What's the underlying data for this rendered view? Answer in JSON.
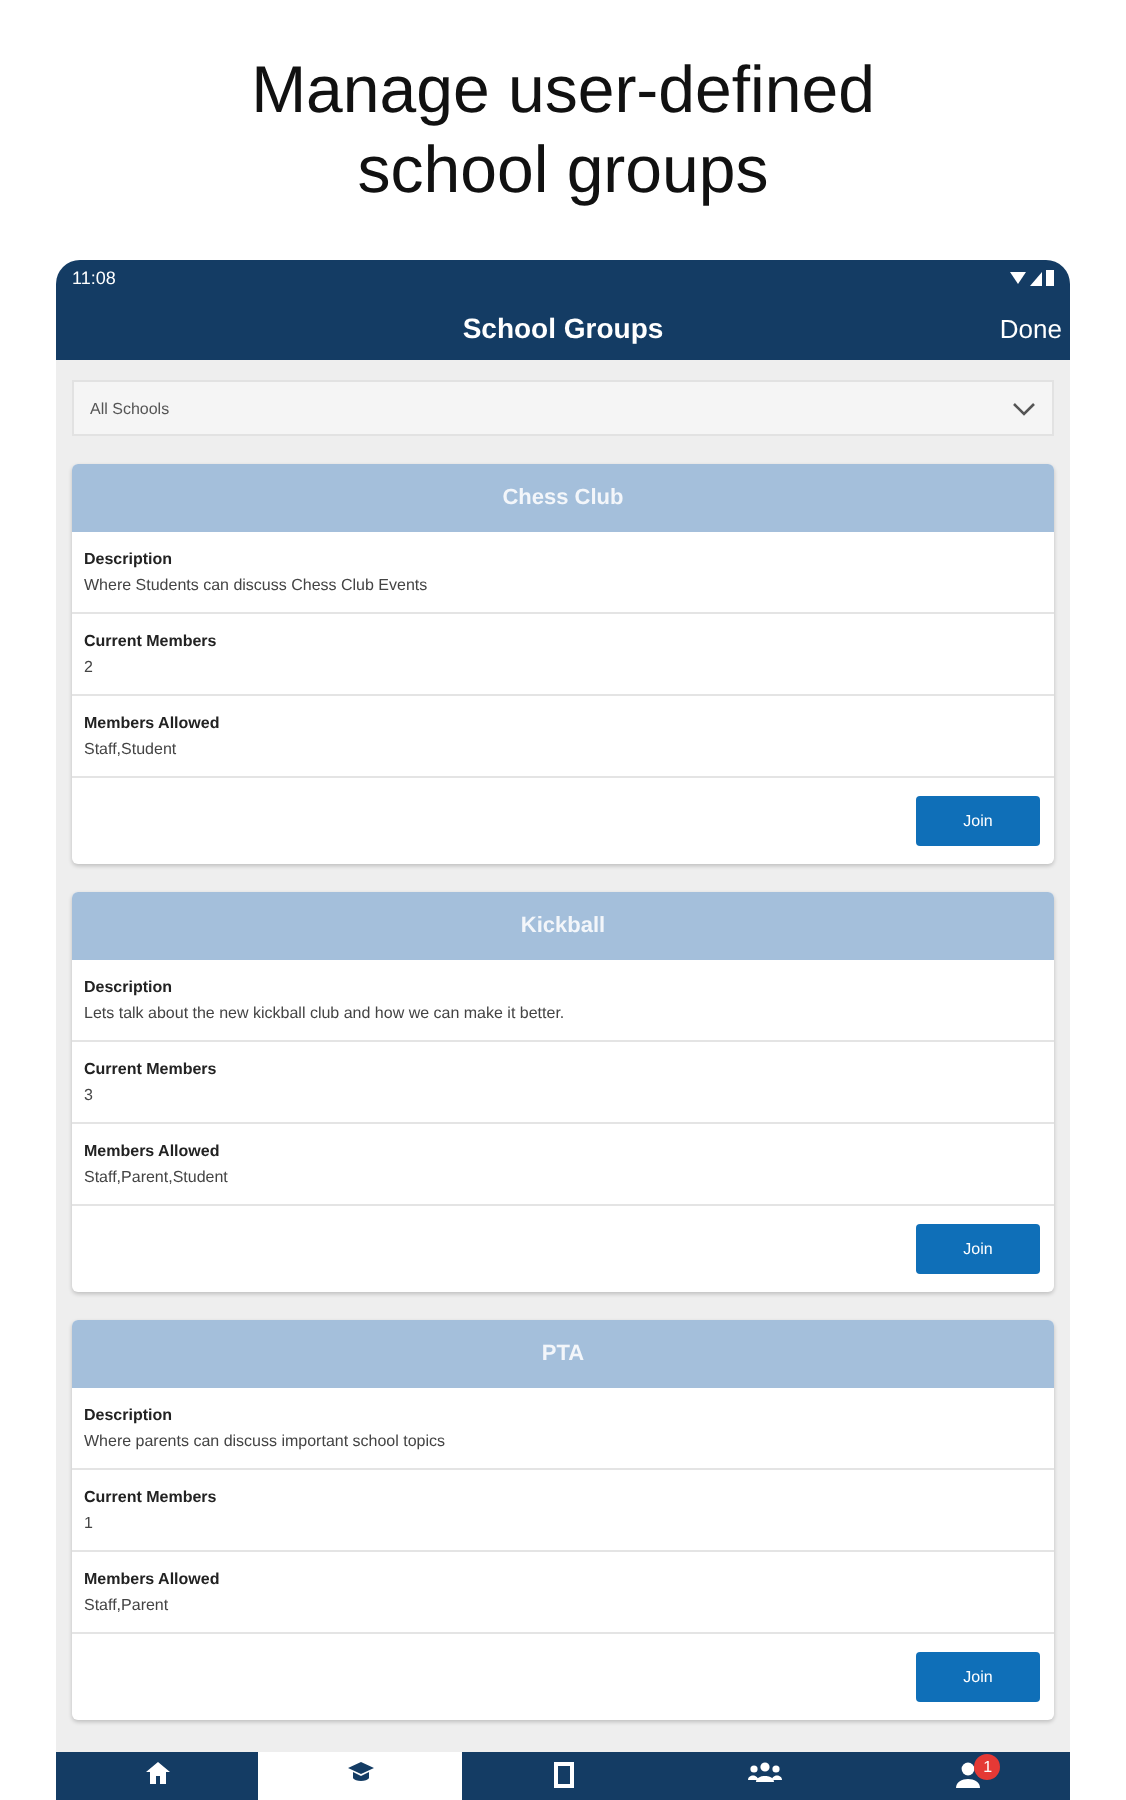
{
  "headline": "Manage user-defined school groups",
  "status_bar": {
    "time": "11:08"
  },
  "title_bar": {
    "title": "School Groups",
    "action": "Done"
  },
  "school_picker": {
    "value": "All Schools"
  },
  "groups": [
    {
      "name": "Chess Club",
      "fields": [
        {
          "label": "Description",
          "value": "Where Students can discuss Chess Club Events"
        },
        {
          "label": "Current Members",
          "value": "2"
        },
        {
          "label": "Members Allowed",
          "value": "Staff,Student"
        }
      ],
      "button": "Join"
    },
    {
      "name": "Kickball",
      "fields": [
        {
          "label": "Description",
          "value": "Lets talk about the new kickball club and how we can make it better."
        },
        {
          "label": "Current Members",
          "value": "3"
        },
        {
          "label": "Members Allowed",
          "value": "Staff,Parent,Student"
        }
      ],
      "button": "Join"
    },
    {
      "name": "PTA",
      "fields": [
        {
          "label": "Description",
          "value": "Where parents can discuss important school topics"
        },
        {
          "label": "Current Members",
          "value": "1"
        },
        {
          "label": "Members Allowed",
          "value": "Staff,Parent"
        }
      ],
      "button": "Join"
    }
  ],
  "bottom_nav": [
    {
      "kind": "home",
      "selected": false
    },
    {
      "kind": "schools",
      "selected": true
    },
    {
      "kind": "classes",
      "selected": false
    },
    {
      "kind": "groups",
      "selected": false
    },
    {
      "kind": "profile",
      "selected": false,
      "badge": "1"
    }
  ]
}
